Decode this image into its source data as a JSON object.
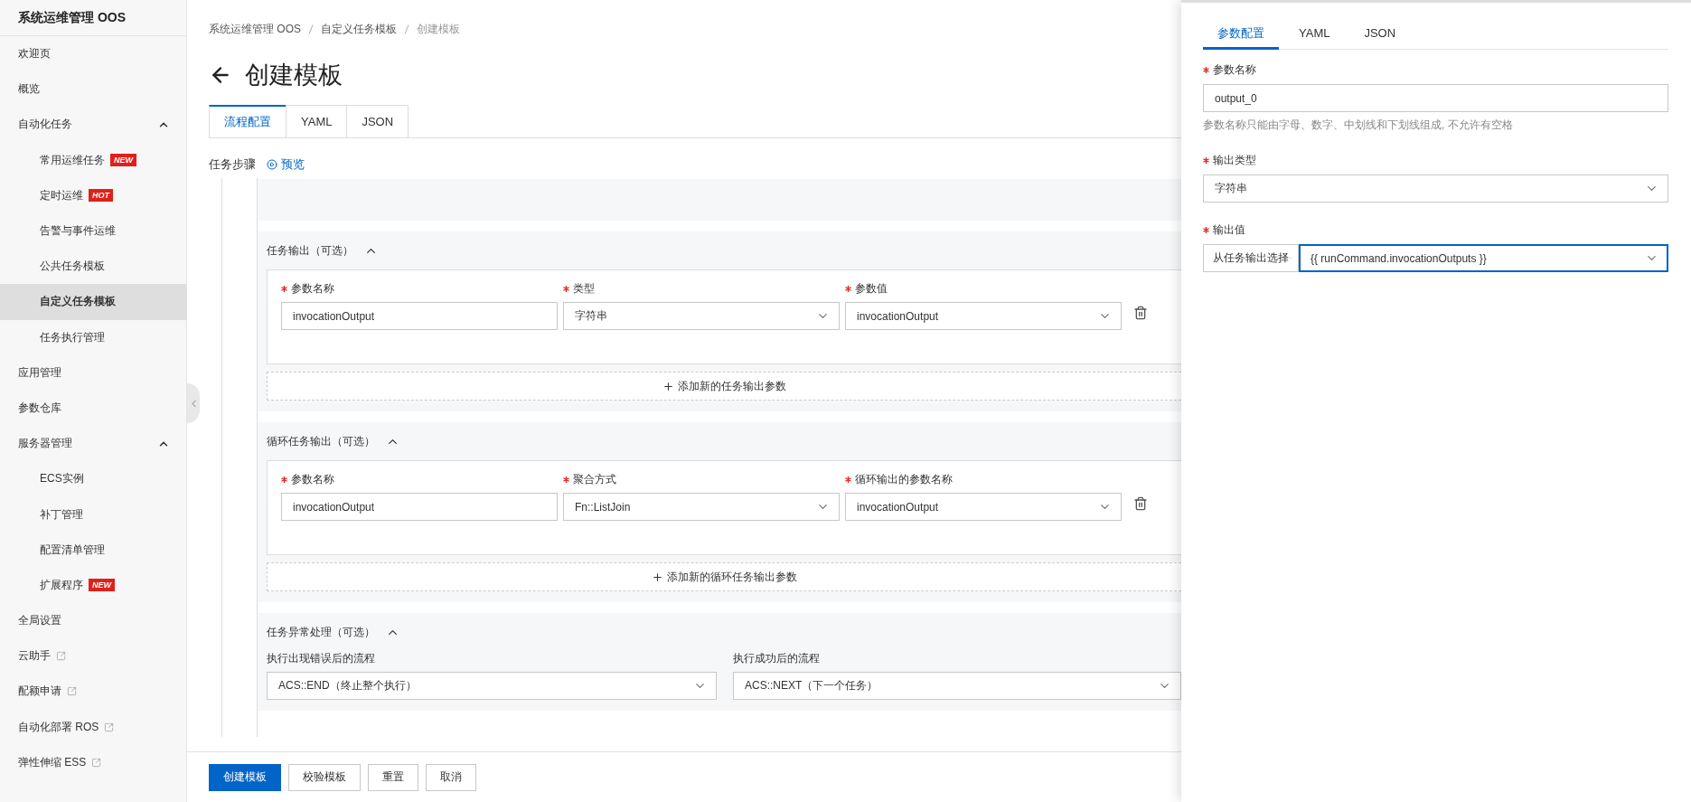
{
  "sidebar": {
    "title": "系统运维管理 OOS",
    "items": [
      {
        "label": "欢迎页",
        "selected": false
      },
      {
        "label": "概览",
        "selected": false
      },
      {
        "label": "自动化任务",
        "selected": false,
        "expanded": true,
        "children": [
          {
            "label": "常用运维任务",
            "selected": false,
            "badge": "NEW"
          },
          {
            "label": "定时运维",
            "selected": false,
            "badge": "HOT"
          },
          {
            "label": "告警与事件运维",
            "selected": false
          },
          {
            "label": "公共任务模板",
            "selected": false
          },
          {
            "label": "自定义任务模板",
            "selected": true
          },
          {
            "label": "任务执行管理",
            "selected": false
          }
        ]
      },
      {
        "label": "应用管理",
        "selected": false
      },
      {
        "label": "参数仓库",
        "selected": false
      },
      {
        "label": "服务器管理",
        "selected": false,
        "expanded": true,
        "children": [
          {
            "label": "ECS实例",
            "selected": false
          },
          {
            "label": "补丁管理",
            "selected": false
          },
          {
            "label": "配置清单管理",
            "selected": false
          },
          {
            "label": "扩展程序",
            "selected": false,
            "badge": "NEW"
          }
        ]
      },
      {
        "label": "全局设置",
        "selected": false
      },
      {
        "label": "云助手",
        "selected": false,
        "external": true
      },
      {
        "label": "配额申请",
        "selected": false,
        "external": true
      },
      {
        "label": "自动化部署 ROS",
        "selected": false,
        "external": true
      },
      {
        "label": "弹性伸缩 ESS",
        "selected": false,
        "external": true
      }
    ]
  },
  "main": {
    "breadcrumb": [
      "系统运维管理 OOS",
      "自定义任务模板",
      "创建模板"
    ],
    "title": "创建模板",
    "tabs": [
      {
        "label": "流程配置",
        "selected": true
      },
      {
        "label": "YAML",
        "selected": false
      },
      {
        "label": "JSON",
        "selected": false
      }
    ],
    "steps_label": "任务步骤",
    "preview_link": "预览",
    "sections": [
      {
        "title": "任务输出（可选）",
        "expanded": true,
        "fields": [
          {
            "label": "参数名称",
            "required": true,
            "kind": "input",
            "value": "invocationOutput"
          },
          {
            "label": "类型",
            "required": true,
            "kind": "select",
            "value": "字符串"
          },
          {
            "label": "参数值",
            "required": true,
            "kind": "select",
            "value": "invocationOutput"
          }
        ],
        "add_button": "添加新的任务输出参数"
      },
      {
        "title": "循环任务输出（可选）",
        "expanded": true,
        "fields": [
          {
            "label": "参数名称",
            "required": true,
            "kind": "input",
            "value": "invocationOutput"
          },
          {
            "label": "聚合方式",
            "required": true,
            "kind": "select",
            "value": "Fn::ListJoin"
          },
          {
            "label": "循环输出的参数名称",
            "required": true,
            "kind": "select",
            "value": "invocationOutput"
          }
        ],
        "add_button": "添加新的循环任务输出参数"
      }
    ],
    "error_section": {
      "title": "任务异常处理（可选）",
      "expanded": true,
      "fields": [
        {
          "label": "执行出现错误后的流程",
          "value": "ACS::END（终止整个执行）"
        },
        {
          "label": "执行成功后的流程",
          "value": "ACS::NEXT（下一个任务）"
        }
      ]
    },
    "buttons": [
      {
        "label": "创建模板",
        "primary": true
      },
      {
        "label": "校验模板",
        "primary": false
      },
      {
        "label": "重置",
        "primary": false
      },
      {
        "label": "取消",
        "primary": false
      }
    ]
  },
  "drawer": {
    "tabs": [
      {
        "label": "参数配置",
        "selected": true
      },
      {
        "label": "YAML",
        "selected": false
      },
      {
        "label": "JSON",
        "selected": false
      }
    ],
    "name_field": {
      "label": "参数名称",
      "required": true,
      "value": "output_0",
      "hint": "参数名称只能由字母、数字、中划线和下划线组成, 不允许有空格"
    },
    "type_field": {
      "label": "输出类型",
      "required": true,
      "value": "字符串"
    },
    "value_field": {
      "label": "输出值",
      "required": true,
      "source": "从任务输出选择",
      "value": "{{ runCommand.invocationOutputs }}",
      "focused": true
    }
  }
}
